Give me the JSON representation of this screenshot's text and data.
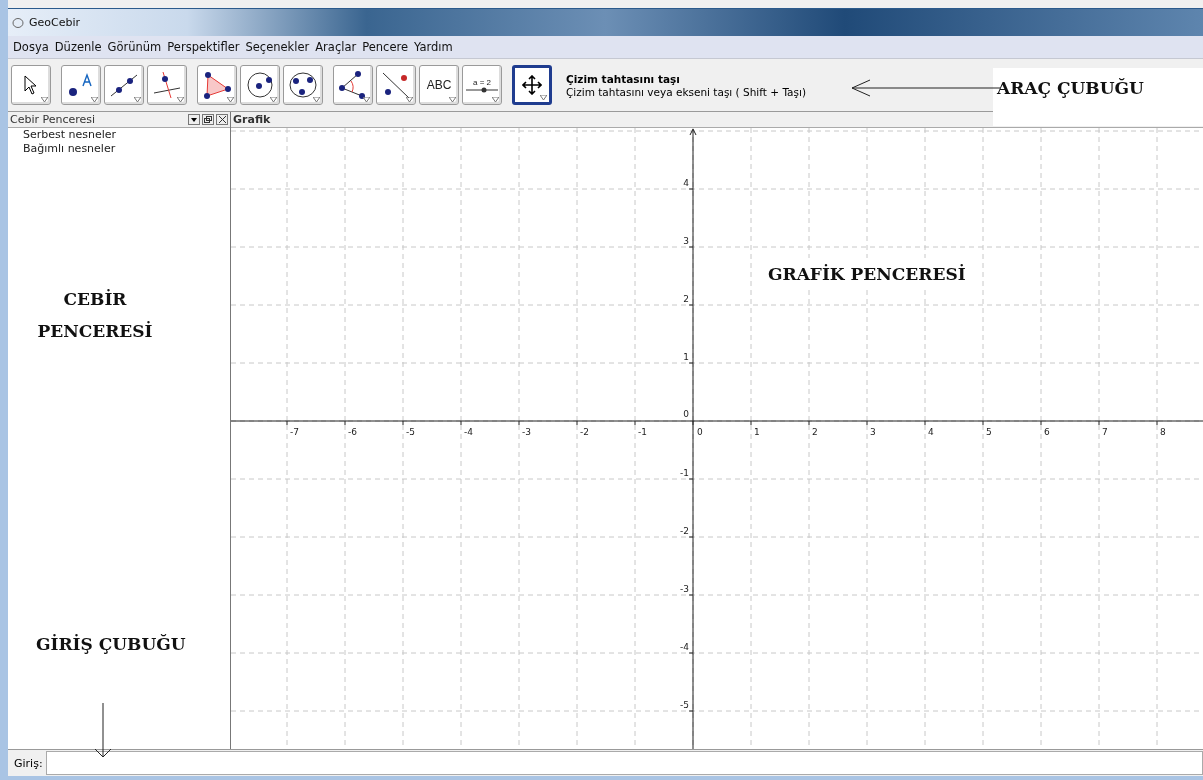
{
  "window": {
    "title": "GeoCebir"
  },
  "menu": [
    "Dosya",
    "Düzenle",
    "Görünüm",
    "Perspektifler",
    "Seçenekler",
    "Araçlar",
    "Pencere",
    "Yardım"
  ],
  "toolbar": {
    "tool_groups": [
      [
        {
          "kind": "move",
          "selected": false
        }
      ],
      [
        {
          "kind": "point",
          "selected": false
        },
        {
          "kind": "line",
          "selected": false
        },
        {
          "kind": "perpendicular",
          "selected": false
        }
      ],
      [
        {
          "kind": "polygon",
          "selected": false
        },
        {
          "kind": "circle",
          "selected": false
        },
        {
          "kind": "conic",
          "selected": false
        }
      ],
      [
        {
          "kind": "angle",
          "selected": false
        },
        {
          "kind": "reflect",
          "selected": false
        },
        {
          "kind": "text",
          "selected": false,
          "label": "ABC"
        },
        {
          "kind": "slider",
          "selected": false,
          "label": "a = 2"
        }
      ],
      [
        {
          "kind": "move-view",
          "selected": true
        }
      ]
    ],
    "info_title": "Çizim tahtasını taşı",
    "info_description": "Çizim tahtasını veya ekseni taşı ( Shift + Taşı)"
  },
  "algebra_panel": {
    "title": "Cebir Penceresi",
    "items": [
      "Serbest nesneler",
      "Bağımlı nesneler"
    ]
  },
  "graphics_panel": {
    "title": "Grafik",
    "origin_label": "0",
    "x_ticks": [
      "-7",
      "-6",
      "-5",
      "-4",
      "-3",
      "-2",
      "-1",
      "0",
      "1",
      "2",
      "3",
      "4",
      "5",
      "6",
      "7",
      "8"
    ],
    "y_ticks": [
      "4",
      "3",
      "2",
      "1",
      "-1",
      "-2",
      "-3",
      "-4",
      "-5"
    ]
  },
  "input_bar": {
    "label": "Giriş:"
  },
  "annotations": [
    {
      "kind": "toolbar",
      "text": "ARAÇ ÇUBUĞU"
    },
    {
      "kind": "graphics",
      "text": "GRAFİK PENCERESİ"
    },
    {
      "kind": "algebra",
      "text": "CEBİR PENCERESİ"
    },
    {
      "kind": "input",
      "text": "GİRİŞ ÇUBUĞU"
    }
  ]
}
